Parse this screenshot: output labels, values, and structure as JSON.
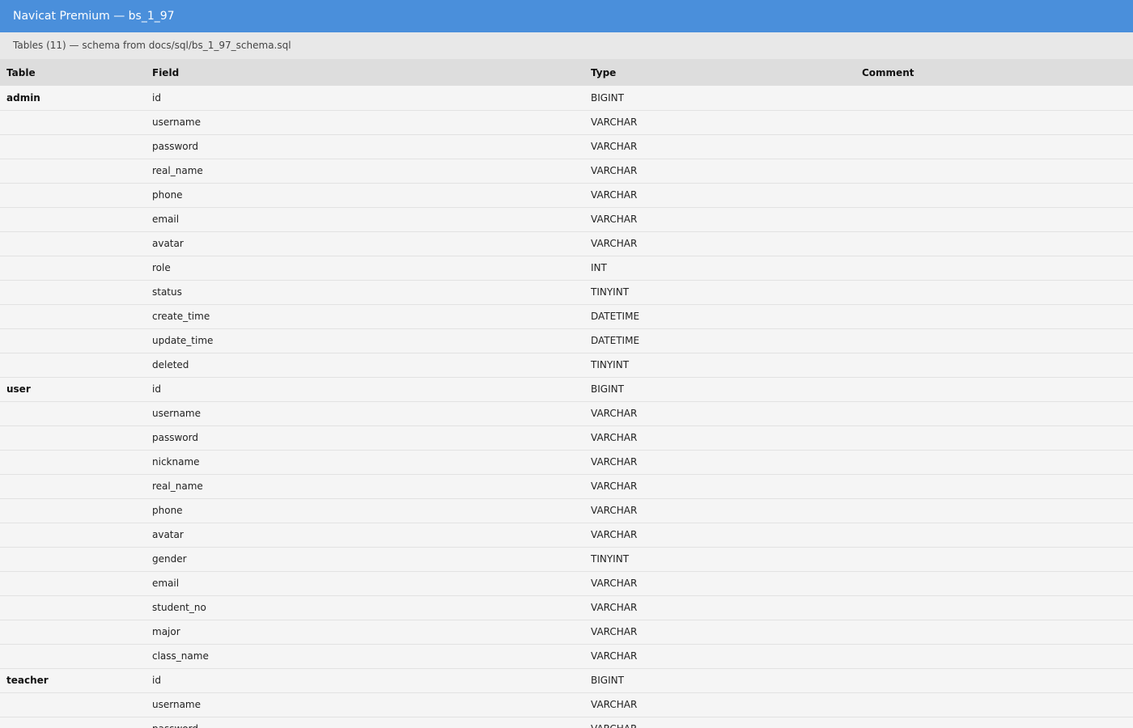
{
  "window": {
    "title": "Navicat Premium — bs_1_97"
  },
  "subtitle": "Tables (11) — schema from docs/sql/bs_1_97_schema.sql",
  "columns": [
    "Table",
    "Field",
    "Type",
    "Comment"
  ],
  "rows": [
    {
      "table": "admin",
      "field": "id",
      "type": "BIGINT",
      "comment": ""
    },
    {
      "table": "",
      "field": "username",
      "type": "VARCHAR",
      "comment": ""
    },
    {
      "table": "",
      "field": "password",
      "type": "VARCHAR",
      "comment": ""
    },
    {
      "table": "",
      "field": "real_name",
      "type": "VARCHAR",
      "comment": ""
    },
    {
      "table": "",
      "field": "phone",
      "type": "VARCHAR",
      "comment": ""
    },
    {
      "table": "",
      "field": "email",
      "type": "VARCHAR",
      "comment": ""
    },
    {
      "table": "",
      "field": "avatar",
      "type": "VARCHAR",
      "comment": ""
    },
    {
      "table": "",
      "field": "role",
      "type": "INT",
      "comment": ""
    },
    {
      "table": "",
      "field": "status",
      "type": "TINYINT",
      "comment": ""
    },
    {
      "table": "",
      "field": "create_time",
      "type": "DATETIME",
      "comment": ""
    },
    {
      "table": "",
      "field": "update_time",
      "type": "DATETIME",
      "comment": ""
    },
    {
      "table": "",
      "field": "deleted",
      "type": "TINYINT",
      "comment": ""
    },
    {
      "table": "user",
      "field": "id",
      "type": "BIGINT",
      "comment": ""
    },
    {
      "table": "",
      "field": "username",
      "type": "VARCHAR",
      "comment": ""
    },
    {
      "table": "",
      "field": "password",
      "type": "VARCHAR",
      "comment": ""
    },
    {
      "table": "",
      "field": "nickname",
      "type": "VARCHAR",
      "comment": ""
    },
    {
      "table": "",
      "field": "real_name",
      "type": "VARCHAR",
      "comment": ""
    },
    {
      "table": "",
      "field": "phone",
      "type": "VARCHAR",
      "comment": ""
    },
    {
      "table": "",
      "field": "avatar",
      "type": "VARCHAR",
      "comment": ""
    },
    {
      "table": "",
      "field": "gender",
      "type": "TINYINT",
      "comment": ""
    },
    {
      "table": "",
      "field": "email",
      "type": "VARCHAR",
      "comment": ""
    },
    {
      "table": "",
      "field": "student_no",
      "type": "VARCHAR",
      "comment": ""
    },
    {
      "table": "",
      "field": "major",
      "type": "VARCHAR",
      "comment": ""
    },
    {
      "table": "",
      "field": "class_name",
      "type": "VARCHAR",
      "comment": ""
    },
    {
      "table": "teacher",
      "field": "id",
      "type": "BIGINT",
      "comment": ""
    },
    {
      "table": "",
      "field": "username",
      "type": "VARCHAR",
      "comment": ""
    },
    {
      "table": "",
      "field": "password",
      "type": "VARCHAR",
      "comment": ""
    }
  ],
  "colors": {
    "titlebar": "#4a8fdb",
    "subbar": "#e8e8e8",
    "header": "#dddddd",
    "row": "#f5f5f5"
  }
}
